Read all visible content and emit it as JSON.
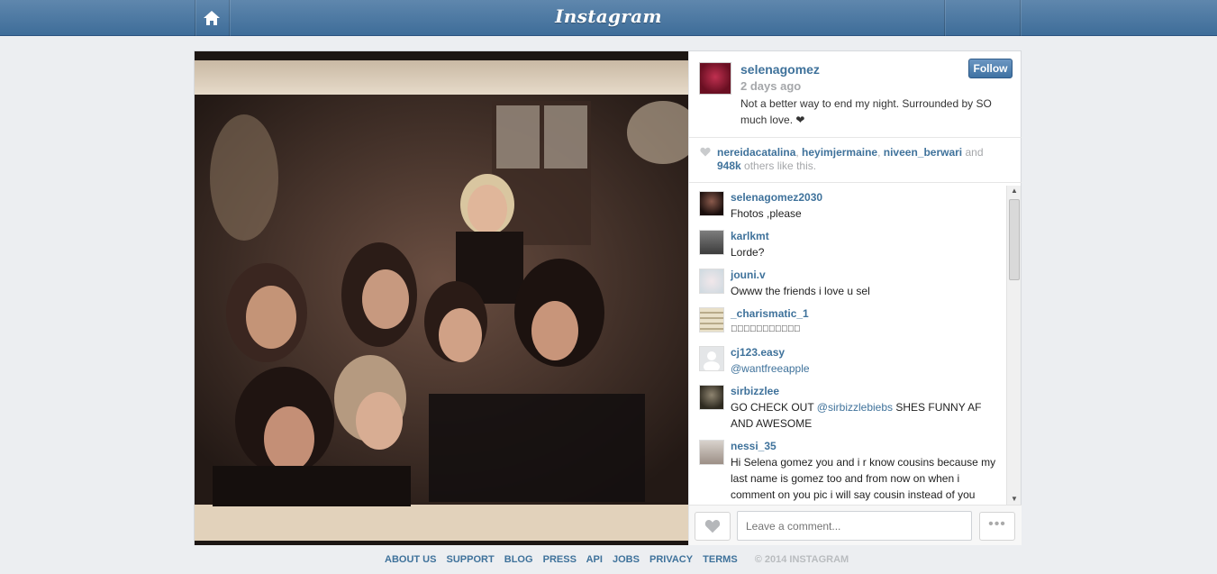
{
  "topbar": {
    "logo": "Instagram",
    "home_icon": "home-icon"
  },
  "post": {
    "username": "selenagomez",
    "time": "2 days ago",
    "caption": "Not a better way to end my night. Surrounded by SO much love. ❤",
    "follow_label": "Follow",
    "likes": {
      "user1": "nereidacatalina",
      "sep1": ", ",
      "user2": "heyimjermaine",
      "sep2": ", ",
      "user3": "niveen_berwari",
      "and": " and",
      "count": "948k",
      "rest": " others like this."
    }
  },
  "comments": [
    {
      "user": "selenagomez2030",
      "text": "Fhotos ,please"
    },
    {
      "user": "karlkmt",
      "text": "Lorde?"
    },
    {
      "user": "jouni.v",
      "text": "Owww the friends i love u sel"
    },
    {
      "user": "_charismatic_1",
      "text": "􏿾􏿾􏿾􏿾􏿾􏿾􏿾􏿾􏿾􏿾􏿾"
    },
    {
      "user": "cj123.easy",
      "mention": "@wantfreeapple"
    },
    {
      "user": "sirbizzlee",
      "text_before": "GO CHECK OUT ",
      "mention": "@sirbizzlebiebs",
      "text_after": " SHES FUNNY AF AND AWESOME"
    },
    {
      "user": "nessi_35",
      "text": "Hi Selena gomez you and i r know cousins because my last name is gomez too and from now on when i comment on you pic i will say cousin instead of you"
    }
  ],
  "comment_box": {
    "placeholder": "Leave a comment...",
    "more_label": "•••"
  },
  "footer": {
    "links": [
      "ABOUT US",
      "SUPPORT",
      "BLOG",
      "PRESS",
      "API",
      "JOBS",
      "PRIVACY",
      "TERMS"
    ],
    "copyright": "© 2014 INSTAGRAM"
  },
  "colors": {
    "link": "#3f729b",
    "topbar": "#4d7aa6",
    "muted": "#a5a7aa"
  }
}
